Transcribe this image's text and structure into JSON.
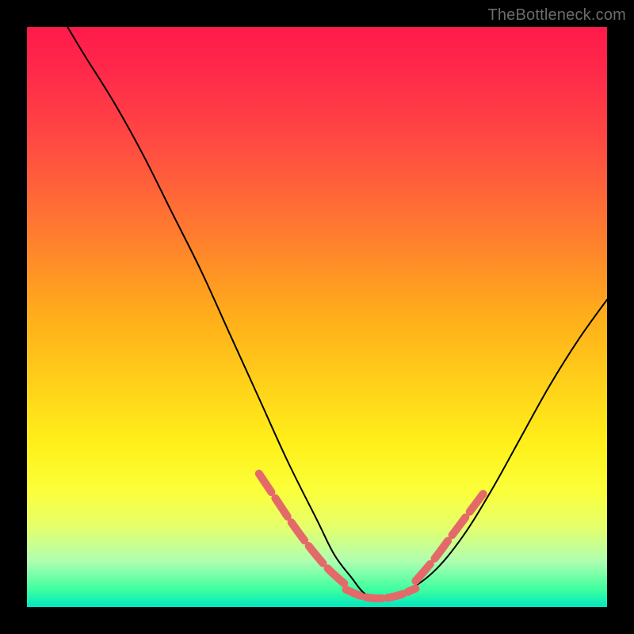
{
  "watermark": "TheBottleneck.com",
  "chart_data": {
    "type": "line",
    "title": "",
    "xlabel": "",
    "ylabel": "",
    "xlim": [
      0,
      100
    ],
    "ylim": [
      0,
      100
    ],
    "grid": false,
    "legend": false,
    "series": [
      {
        "name": "bottleneck-curve",
        "color": "#000000",
        "stroke_width": 2,
        "x": [
          7,
          10,
          15,
          20,
          25,
          30,
          35,
          40,
          45,
          50,
          53,
          56,
          58,
          60,
          62,
          65,
          70,
          75,
          80,
          85,
          90,
          95,
          100
        ],
        "y": [
          100,
          95,
          87,
          78,
          68,
          58,
          47,
          36,
          25,
          15,
          9,
          5,
          2.5,
          1.5,
          1.5,
          2.5,
          6,
          12,
          20,
          29,
          38,
          46,
          53
        ]
      },
      {
        "name": "highlight-left-segment",
        "color": "#e46a6a",
        "stroke_width": 10,
        "dash": "28 9",
        "x": [
          40,
          43,
          46,
          49,
          52,
          55
        ],
        "y": [
          23,
          18.5,
          14,
          10,
          6.5,
          3.8
        ]
      },
      {
        "name": "highlight-bottom-segment",
        "color": "#e46a6a",
        "stroke_width": 10,
        "dash": "20 7",
        "x": [
          55,
          58,
          61,
          64,
          67
        ],
        "y": [
          3.0,
          1.8,
          1.5,
          2.0,
          3.2
        ]
      },
      {
        "name": "highlight-right-segment",
        "color": "#e46a6a",
        "stroke_width": 10,
        "dash": "28 9",
        "x": [
          67,
          70,
          73,
          76,
          79
        ],
        "y": [
          4.5,
          8,
          12,
          16,
          20
        ]
      }
    ]
  }
}
